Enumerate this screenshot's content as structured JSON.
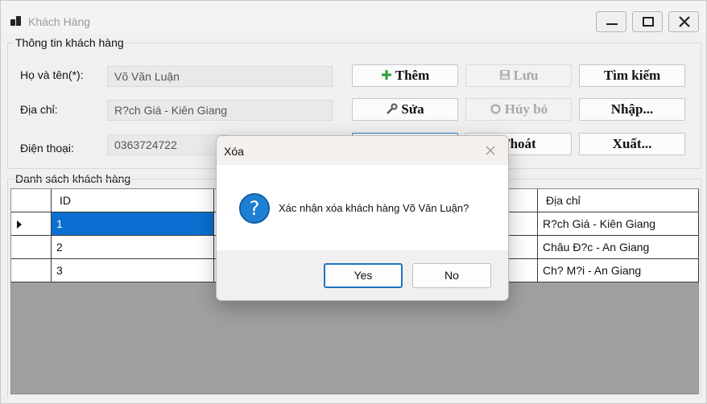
{
  "window": {
    "title": "Khách Hàng"
  },
  "info_group": {
    "title": "Thông tin khách hàng",
    "labels": {
      "name": "Họ và tên(*):",
      "address": "Địa chỉ:",
      "phone": "Điện thoại:"
    },
    "values": {
      "name": "Võ Văn Luận",
      "address": "R?ch Giá - Kiên Giang",
      "phone": "0363724722"
    }
  },
  "buttons": {
    "add": "Thêm",
    "save": "Lưu",
    "search": "Tìm kiếm",
    "edit": "Sửa",
    "cancel": "Hủy bỏ",
    "import": "Nhập...",
    "exit": "Thoát",
    "export": "Xuất..."
  },
  "list_group": {
    "title": "Danh sách khách hàng",
    "columns": {
      "id": "ID",
      "address": "Địa chỉ"
    },
    "rows": [
      {
        "id": "1",
        "address": "R?ch Giá - Kiên Giang"
      },
      {
        "id": "2",
        "address": "Châu Đ?c - An Giang"
      },
      {
        "id": "3",
        "address": "Ch? M?i - An Giang"
      }
    ]
  },
  "dialog": {
    "title": "Xóa",
    "message": "Xác nhận xóa khách hàng Võ Văn Luận?",
    "yes": "Yes",
    "no": "No"
  },
  "icons": {
    "app": "app-icon",
    "add": "plus-icon",
    "save": "floppy-icon",
    "edit": "wrench-icon",
    "cancel": "undo-icon",
    "question": "question-icon"
  },
  "colors": {
    "selection": "#0a6fd0",
    "add_icon": "#2e9e3e",
    "dialog_icon": "#1f7fd3"
  }
}
